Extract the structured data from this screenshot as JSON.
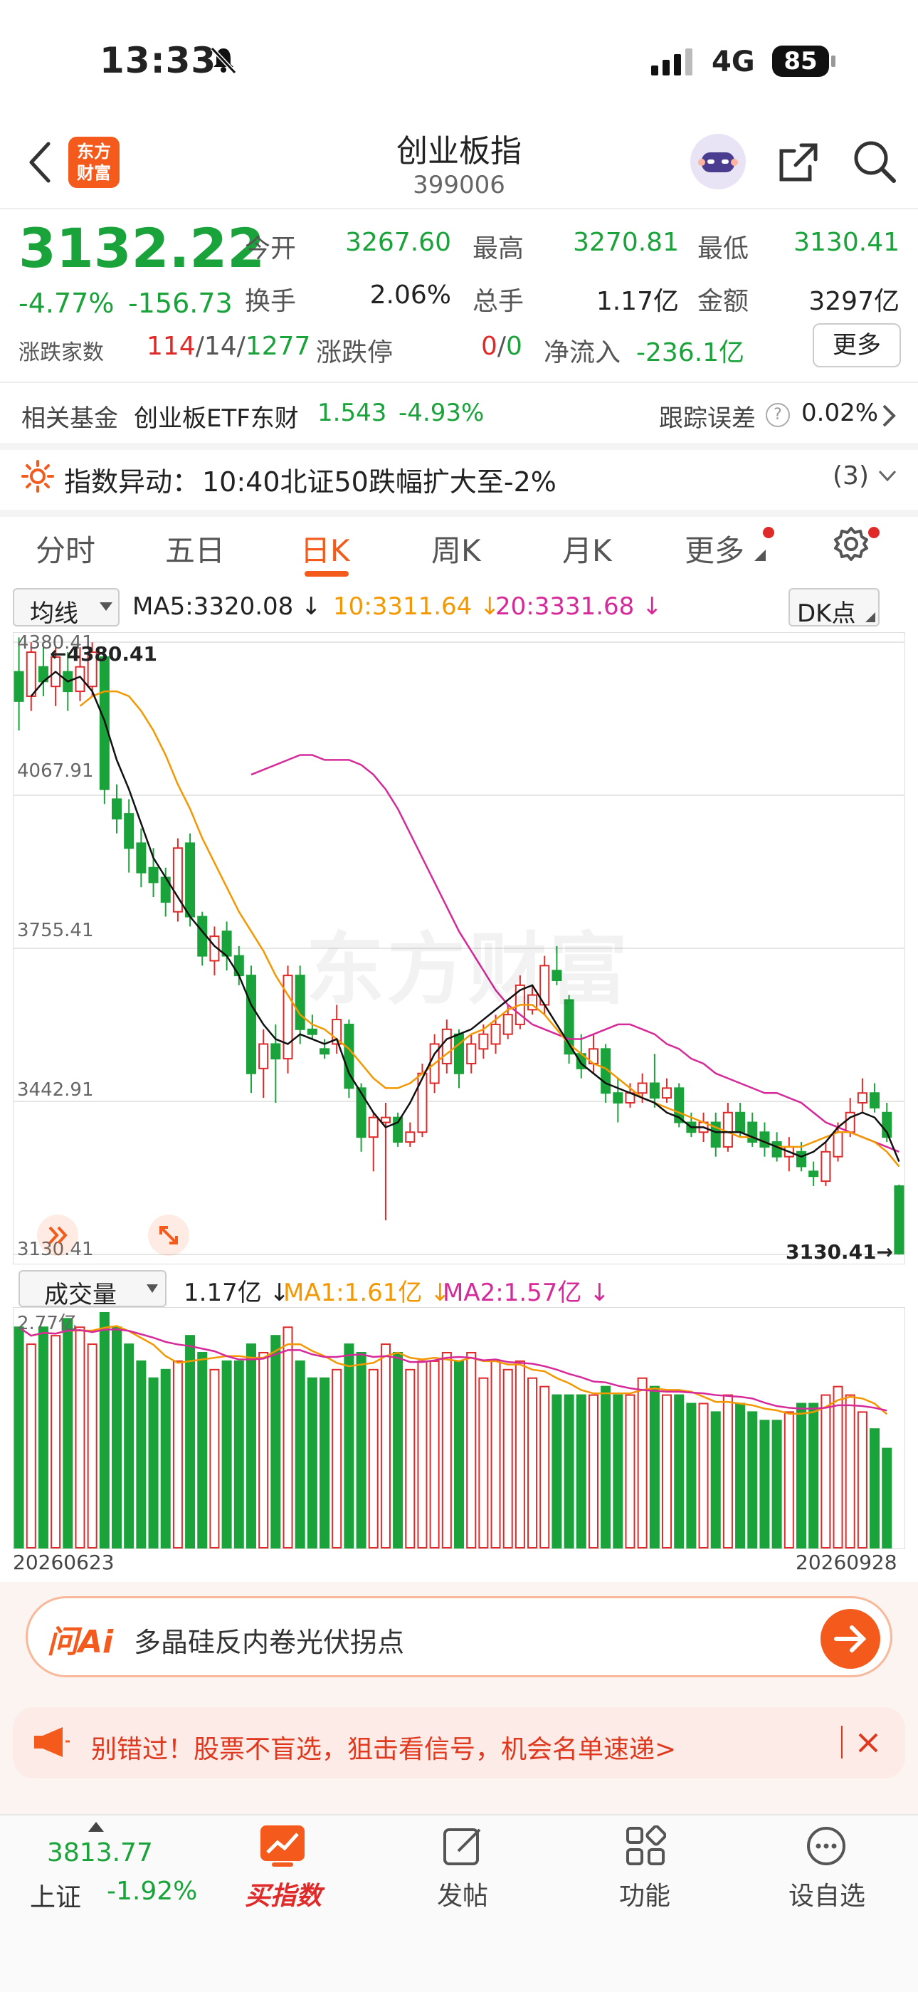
{
  "status": {
    "time": "13:33",
    "network": "4G",
    "battery": "85"
  },
  "nav": {
    "title": "创业板指",
    "code": "399006",
    "logo_text": "东方财富"
  },
  "quote": {
    "price": "3132.22",
    "change_pct": "-4.77%",
    "change_abs": "-156.73",
    "open_label": "今开",
    "open": "3267.60",
    "high_label": "最高",
    "high": "3270.81",
    "low_label": "最低",
    "low": "3130.41",
    "turnover_label": "换手",
    "turnover": "2.06%",
    "volume_label": "总手",
    "volume": "1.17亿",
    "amount_label": "金额",
    "amount": "3297亿",
    "breadth_label": "涨跌家数",
    "breadth_up": "114",
    "breadth_flat": "14",
    "breadth_down": "1277",
    "limit_label": "涨跌停",
    "limit_up": "0",
    "limit_down": "0",
    "inflow_label": "净流入",
    "inflow": "-236.1亿",
    "more_label": "更多"
  },
  "fund": {
    "label": "相关基金",
    "name": "创业板ETF东财",
    "price": "1.543",
    "pct": "-4.93%",
    "tracking_label": "跟踪误差",
    "tracking_value": "0.02%"
  },
  "alert": {
    "label": "指数异动：",
    "text": "10:40北证50跌幅扩大至-2%",
    "count": "(3)"
  },
  "tabs": [
    "分时",
    "五日",
    "日K",
    "周K",
    "月K",
    "更多"
  ],
  "active_tab": "日K",
  "ma_legend": {
    "select": "均线",
    "ma5": "MA5:3320.08 ↓",
    "ma10": "10:3311.64 ↓",
    "ma20": "20:3331.68 ↓",
    "dk": "DK点"
  },
  "vol_legend": {
    "select": "成交量",
    "vol": "1.17亿 ↓",
    "ma1": "MA1:1.61亿 ↓",
    "ma2": "MA2:1.57亿 ↓",
    "max": "2.77亿"
  },
  "axis": {
    "start_date": "20260623",
    "end_date": "20260928",
    "high_marker": "←4380.41",
    "low_marker": "3130.41→",
    "watermark": "东方财富"
  },
  "ai": {
    "logo": "问Ai",
    "text": "多晶硅反内卷光伏拐点"
  },
  "promo": {
    "text": "别错过！股票不盲选，狙击看信号，机会名单速递>"
  },
  "bottom_nav": {
    "index_value": "3813.77",
    "index_name": "上证",
    "index_pct": "-1.92%",
    "buy_label": "买指数",
    "post_label": "发帖",
    "func_label": "功能",
    "watch_label": "设自选"
  },
  "colors": {
    "up": "#e02a2a",
    "down": "#1aa33a",
    "ma5": "#111111",
    "ma10": "#f39800",
    "ma20": "#d6299a",
    "accent": "#f35a1b"
  },
  "chart_data": {
    "type": "candlestick",
    "y_ticks": [
      4380.41,
      4067.91,
      3755.41,
      3442.91,
      3130.41
    ],
    "ylim": [
      3130.41,
      4380.41
    ],
    "candles": [
      [
        4320,
        4260,
        4390,
        4200
      ],
      [
        4270,
        4360,
        4380,
        4240
      ],
      [
        4330,
        4300,
        4370,
        4270
      ],
      [
        4290,
        4350,
        4370,
        4250
      ],
      [
        4320,
        4280,
        4360,
        4240
      ],
      [
        4280,
        4330,
        4370,
        4260
      ],
      [
        4290,
        4360,
        4380,
        4270
      ],
      [
        4350,
        4080,
        4360,
        4050
      ],
      [
        4060,
        4020,
        4090,
        3990
      ],
      [
        4030,
        3960,
        4060,
        3910
      ],
      [
        3970,
        3910,
        4000,
        3880
      ],
      [
        3920,
        3890,
        3960,
        3860
      ],
      [
        3900,
        3850,
        3920,
        3820
      ],
      [
        3830,
        3960,
        3980,
        3810
      ],
      [
        3970,
        3820,
        3990,
        3800
      ],
      [
        3820,
        3740,
        3830,
        3720
      ],
      [
        3730,
        3780,
        3800,
        3700
      ],
      [
        3790,
        3740,
        3810,
        3710
      ],
      [
        3740,
        3700,
        3760,
        3680
      ],
      [
        3700,
        3500,
        3720,
        3460
      ],
      [
        3510,
        3560,
        3590,
        3450
      ],
      [
        3560,
        3530,
        3600,
        3440
      ],
      [
        3530,
        3700,
        3720,
        3500
      ],
      [
        3700,
        3590,
        3720,
        3560
      ],
      [
        3590,
        3580,
        3620,
        3570
      ],
      [
        3550,
        3540,
        3570,
        3530
      ],
      [
        3560,
        3610,
        3640,
        3540
      ],
      [
        3600,
        3470,
        3610,
        3450
      ],
      [
        3470,
        3370,
        3480,
        3340
      ],
      [
        3370,
        3410,
        3420,
        3300
      ],
      [
        3400,
        3410,
        3440,
        3200
      ],
      [
        3410,
        3360,
        3420,
        3350
      ],
      [
        3360,
        3380,
        3400,
        3350
      ],
      [
        3380,
        3500,
        3520,
        3370
      ],
      [
        3480,
        3560,
        3580,
        3460
      ],
      [
        3520,
        3590,
        3610,
        3500
      ],
      [
        3580,
        3500,
        3590,
        3470
      ],
      [
        3520,
        3560,
        3580,
        3500
      ],
      [
        3550,
        3580,
        3600,
        3530
      ],
      [
        3560,
        3600,
        3620,
        3540
      ],
      [
        3580,
        3620,
        3640,
        3570
      ],
      [
        3600,
        3680,
        3700,
        3590
      ],
      [
        3630,
        3660,
        3680,
        3620
      ],
      [
        3640,
        3720,
        3740,
        3620
      ],
      [
        3710,
        3690,
        3760,
        3680
      ],
      [
        3650,
        3540,
        3660,
        3520
      ],
      [
        3540,
        3510,
        3580,
        3490
      ],
      [
        3520,
        3550,
        3580,
        3500
      ],
      [
        3550,
        3460,
        3560,
        3440
      ],
      [
        3460,
        3440,
        3490,
        3400
      ],
      [
        3440,
        3460,
        3480,
        3430
      ],
      [
        3460,
        3480,
        3500,
        3440
      ],
      [
        3480,
        3450,
        3540,
        3430
      ],
      [
        3450,
        3470,
        3490,
        3440
      ],
      [
        3470,
        3400,
        3480,
        3390
      ],
      [
        3400,
        3380,
        3420,
        3370
      ],
      [
        3380,
        3400,
        3420,
        3360
      ],
      [
        3400,
        3350,
        3420,
        3330
      ],
      [
        3350,
        3420,
        3440,
        3340
      ],
      [
        3420,
        3380,
        3440,
        3370
      ],
      [
        3400,
        3360,
        3420,
        3350
      ],
      [
        3380,
        3350,
        3400,
        3330
      ],
      [
        3360,
        3330,
        3380,
        3320
      ],
      [
        3330,
        3350,
        3370,
        3300
      ],
      [
        3340,
        3310,
        3360,
        3300
      ],
      [
        3300,
        3290,
        3320,
        3270
      ],
      [
        3280,
        3340,
        3360,
        3270
      ],
      [
        3330,
        3380,
        3400,
        3320
      ],
      [
        3380,
        3420,
        3450,
        3370
      ],
      [
        3440,
        3460,
        3490,
        3420
      ],
      [
        3460,
        3430,
        3480,
        3420
      ],
      [
        3420,
        3370,
        3440,
        3360
      ],
      [
        3270,
        3132,
        3273,
        3130
      ]
    ],
    "ma5": [
      4270,
      4300,
      4320,
      4300,
      4310,
      4280,
      4220,
      4140,
      4080,
      4010,
      3940,
      3900,
      3860,
      3820,
      3790,
      3760,
      3740,
      3700,
      3640,
      3600,
      3570,
      3560,
      3580,
      3570,
      3560,
      3570,
      3500,
      3460,
      3420,
      3390,
      3400,
      3440,
      3490,
      3540,
      3570,
      3580,
      3590,
      3610,
      3630,
      3650,
      3670,
      3680,
      3640,
      3600,
      3560,
      3520,
      3500,
      3480,
      3470,
      3460,
      3450,
      3440,
      3420,
      3410,
      3390,
      3390,
      3380,
      3380,
      3380,
      3370,
      3360,
      3350,
      3340,
      3330,
      3340,
      3360,
      3390,
      3410,
      3420,
      3410,
      3380,
      3320
    ],
    "ma10": [
      4250,
      4270,
      4280,
      4280,
      4270,
      4240,
      4200,
      4150,
      4090,
      4040,
      3980,
      3930,
      3880,
      3830,
      3790,
      3750,
      3700,
      3660,
      3620,
      3600,
      3590,
      3570,
      3550,
      3520,
      3490,
      3470,
      3470,
      3480,
      3500,
      3520,
      3540,
      3560,
      3580,
      3590,
      3610,
      3630,
      3640,
      3640,
      3620,
      3590,
      3560,
      3540,
      3520,
      3510,
      3490,
      3470,
      3450,
      3440,
      3430,
      3420,
      3410,
      3400,
      3390,
      3380,
      3370,
      3370,
      3360,
      3350,
      3350,
      3350,
      3360,
      3370,
      3380,
      3380,
      3370,
      3360,
      3340,
      3310
    ],
    "ma20": [
      4110,
      4120,
      4130,
      4140,
      4150,
      4150,
      4140,
      4140,
      4140,
      4130,
      4110,
      4080,
      4040,
      3990,
      3940,
      3890,
      3840,
      3790,
      3750,
      3710,
      3670,
      3640,
      3620,
      3600,
      3590,
      3580,
      3570,
      3570,
      3580,
      3590,
      3600,
      3600,
      3590,
      3580,
      3560,
      3550,
      3530,
      3520,
      3500,
      3490,
      3480,
      3470,
      3460,
      3460,
      3450,
      3440,
      3420,
      3400,
      3390,
      3380,
      3370,
      3360,
      3350,
      3340
    ],
    "volume_max": 2.77,
    "volumes": [
      2.6,
      2.4,
      2.6,
      2.5,
      2.7,
      2.6,
      2.4,
      2.77,
      2.6,
      2.4,
      2.2,
      2.0,
      2.1,
      2.2,
      2.5,
      2.3,
      2.1,
      2.2,
      2.2,
      2.4,
      2.3,
      2.5,
      2.6,
      2.2,
      2.0,
      2.0,
      2.1,
      2.4,
      2.3,
      2.1,
      2.4,
      2.3,
      2.1,
      2.2,
      2.2,
      2.3,
      2.2,
      2.3,
      2.0,
      2.2,
      2.1,
      2.2,
      2.0,
      1.9,
      1.8,
      1.8,
      1.8,
      1.8,
      1.9,
      1.8,
      1.8,
      2.0,
      1.9,
      1.8,
      1.8,
      1.7,
      1.7,
      1.6,
      1.8,
      1.7,
      1.6,
      1.5,
      1.5,
      1.6,
      1.7,
      1.7,
      1.8,
      1.9,
      1.8,
      1.6,
      1.4,
      1.17
    ]
  }
}
